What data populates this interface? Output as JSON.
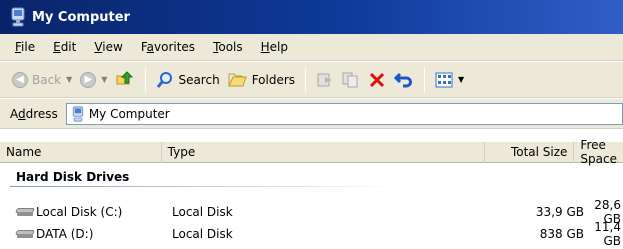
{
  "window": {
    "title": "My Computer"
  },
  "menu": [
    {
      "label": "File",
      "mnemonic": "F"
    },
    {
      "label": "Edit",
      "mnemonic": "E"
    },
    {
      "label": "View",
      "mnemonic": "V"
    },
    {
      "label": "Favorites",
      "mnemonic": "a"
    },
    {
      "label": "Tools",
      "mnemonic": "T"
    },
    {
      "label": "Help",
      "mnemonic": "H"
    }
  ],
  "toolbar": {
    "back_label": "Back",
    "search_label": "Search",
    "folders_label": "Folders"
  },
  "address": {
    "label": "Address",
    "value": "My Computer"
  },
  "columns": {
    "name": "Name",
    "type": "Type",
    "total": "Total Size",
    "free": "Free Space"
  },
  "groups": [
    {
      "title": "Hard Disk Drives",
      "items": [
        {
          "name": "Local Disk (C:)",
          "type": "Local Disk",
          "total": "33,9 GB",
          "free": "28,6 GB"
        },
        {
          "name": "DATA (D:)",
          "type": "Local Disk",
          "total": "838 GB",
          "free": "11,4 GB"
        }
      ]
    }
  ],
  "colors": {
    "title_bar": "#0a246a",
    "chrome": "#ece9d8",
    "search_red_x": "#e01010"
  }
}
